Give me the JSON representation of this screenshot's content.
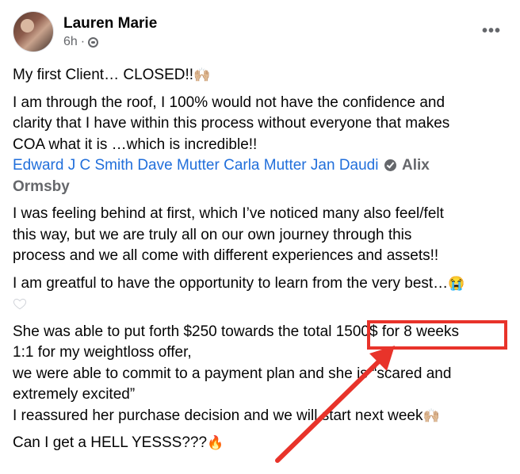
{
  "post": {
    "author": "Lauren Marie",
    "time": "6h",
    "separator": "·",
    "privacy_icon": "globe-icon",
    "more_label": "•••"
  },
  "content": {
    "p1": "My first Client… CLOSED!!",
    "p1_emoji": "🙌🏼",
    "p2_l1": "I am through the roof, I 100% would not have the confidence and",
    "p2_l2": "clarity that I have within this process without everyone that makes",
    "p2_l3": "COA what it is …which is incredible!!",
    "mention1": "Edward J C Smith",
    "mention2": "Dave Mutter",
    "mention3": "Carla Mutter",
    "mention4": "Jan Daudi",
    "mention5_a": "Alix",
    "mention5_b": "Ormsby",
    "p3_l1": "I was feeling behind at first, which I’ve noticed many also feel/felt",
    "p3_l2": "this way, but we are truly all on our own journey through this",
    "p3_l3": "process and we all come with different experiences and assets!!",
    "p4_l1": "I am greatful to have the opportunity to learn from the very best…",
    "p4_emoji": "😭",
    "p5_l1": "She was able to put forth $250 towards the total 1500$ for 8 weeks",
    "p5_l2": "1:1 for my weightloss offer,",
    "p5_l3": "we were able to commit to a payment plan and she is “scared and",
    "p5_l4": "extremely excited”",
    "p5_l5": "I reassured her purchase decision and we will start next week",
    "p5_emoji": "🙌🏼",
    "p6": "Can I get a HELL YESSS???",
    "p6_emoji": "🔥"
  },
  "annotation": {
    "box_color": "#e8332a",
    "arrow_color": "#e8332a"
  },
  "colors": {
    "link": "#216fdb",
    "muted": "#65676b",
    "text": "#050505"
  }
}
